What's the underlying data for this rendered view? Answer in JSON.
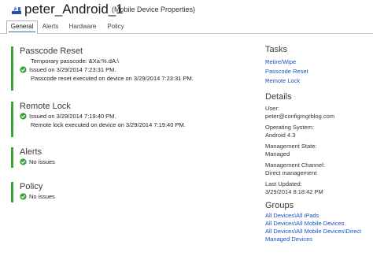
{
  "header": {
    "title": "peter_Android_1",
    "subtitle": "(Mobile Device Properties)"
  },
  "tabs": [
    {
      "label": "General",
      "active": true
    },
    {
      "label": "Alerts",
      "active": false
    },
    {
      "label": "Hardware",
      "active": false
    },
    {
      "label": "Policy",
      "active": false
    }
  ],
  "sections": {
    "passcode": {
      "title": "Passcode Reset",
      "temp_passcode": "Temporary passcode:  &Xa:%.dA:\\",
      "issued": "Issued on 3/29/2014 7:23:31 PM.",
      "executed": "Passcode reset executed on device on 3/29/2014 7:23:31 PM."
    },
    "remote_lock": {
      "title": "Remote Lock",
      "issued": "Issued on 3/29/2014 7:19:40 PM.",
      "executed": "Remote lock executed on device on 3/29/2014 7:19:40 PM."
    },
    "alerts": {
      "title": "Alerts",
      "status": "No issues"
    },
    "policy": {
      "title": "Policy",
      "status": "No issues"
    }
  },
  "tasks": {
    "title": "Tasks",
    "items": [
      "Retire/Wipe",
      "Passcode Reset",
      "Remote Lock"
    ]
  },
  "details": {
    "title": "Details",
    "user_label": "User:",
    "user_value": "peter@configmgrblog.com",
    "os_label": "Operating System:",
    "os_value": "Android 4.3",
    "state_label": "Management State:",
    "state_value": "Managed",
    "channel_label": "Management Channel:",
    "channel_value": "Direct management",
    "updated_label": "Last Updated:",
    "updated_value": "3/29/2014 8:18:42 PM"
  },
  "groups": {
    "title": "Groups",
    "items": [
      "All Devices\\All iPads",
      "All Devices\\All Mobile Devices",
      "All Devices\\All Mobile Devices\\Direct",
      "Managed Devices"
    ]
  },
  "colors": {
    "accent_green": "#39a336",
    "link_blue": "#1a52c4",
    "tab_underline": "#3070c0"
  },
  "icons": {
    "check": "check-circle-icon",
    "logo": "device-logo-icon"
  }
}
